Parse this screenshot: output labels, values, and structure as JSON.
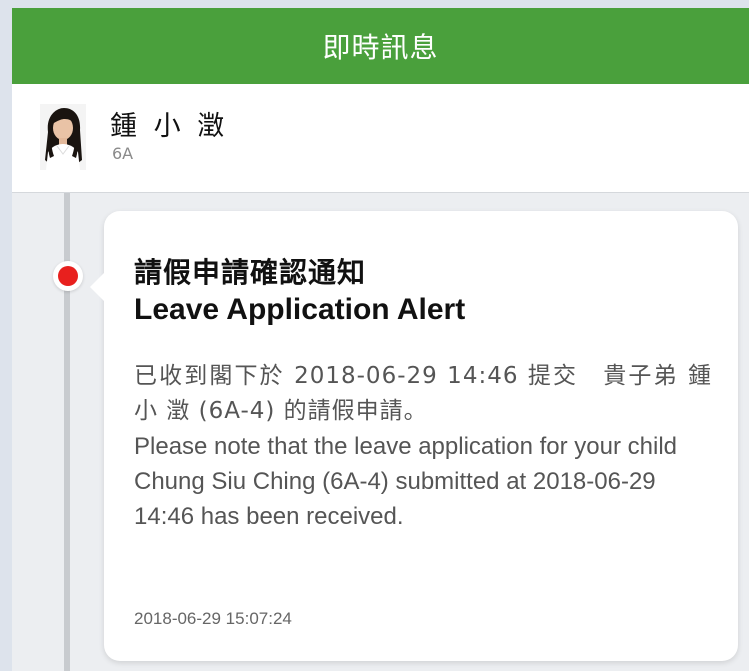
{
  "header": {
    "title": "即時訊息"
  },
  "profile": {
    "name": "鍾 小 澂",
    "class": "6A"
  },
  "message": {
    "title_zh": "請假申請確認通知",
    "title_en": "Leave Application Alert",
    "body_zh": "已收到閣下於 2018-06-29 14:46 提交　貴子弟 鍾 小 澂 (6A-4) 的請假申請。",
    "body_en": "Please note that the leave application for your child Chung Siu Ching (6A-4) submitted at 2018-06-29 14:46 has been received.",
    "timestamp": "2018-06-29 15:07:24",
    "status": "unread"
  },
  "colors": {
    "header_bg": "#4aa03c",
    "unread_dot": "#e8201e",
    "background": "#eceef1"
  },
  "icons": {
    "avatar": "student-photo-avatar",
    "dot": "unread-dot-icon"
  }
}
